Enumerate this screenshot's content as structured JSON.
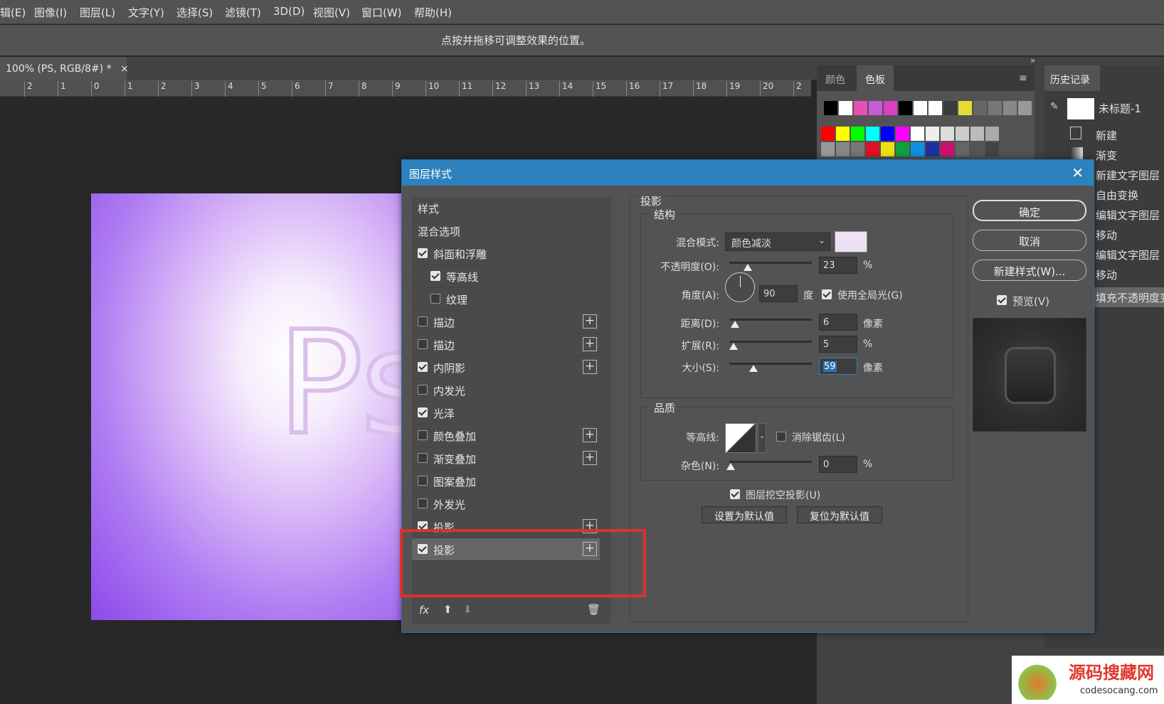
{
  "menu": [
    "辑(E)",
    "图像(I)",
    "图层(L)",
    "文字(Y)",
    "选择(S)",
    "滤镜(T)",
    "3D(D)",
    "视图(V)",
    "窗口(W)",
    "帮助(H)"
  ],
  "options_hint": "点按并拖移可调整效果的位置。",
  "doc_tab": {
    "label": "100% (PS, RGB/8#) *",
    "close": "×"
  },
  "ruler_ticks": [
    "2",
    "1",
    "0",
    "1",
    "2",
    "3",
    "4",
    "5",
    "6",
    "7",
    "8",
    "9",
    "10",
    "11",
    "12",
    "13",
    "14",
    "15",
    "16",
    "17",
    "18",
    "19",
    "20",
    "2"
  ],
  "canvas_text": "Ps",
  "swatch_tabs": {
    "color": "颜色",
    "swatches": "色板",
    "menu": "≡",
    "collapse": "»"
  },
  "history": {
    "tab": "历史记录",
    "snapshot": "未标题-1",
    "items": [
      "新建",
      "渐变",
      "新建文字图层",
      "自由变换",
      "编辑文字图层",
      "移动",
      "编辑文字图层",
      "移动",
      "填充不透明度变"
    ]
  },
  "dialog": {
    "title": "图层样式",
    "close": "✕",
    "styles": [
      {
        "label": "样式",
        "check": null,
        "plus": false
      },
      {
        "label": "混合选项",
        "check": null,
        "plus": false
      },
      {
        "label": "斜面和浮雕",
        "check": true,
        "plus": false
      },
      {
        "label": "等高线",
        "check": true,
        "plus": false,
        "indent": true
      },
      {
        "label": "纹理",
        "check": false,
        "plus": false,
        "indent": true
      },
      {
        "label": "描边",
        "check": false,
        "plus": true
      },
      {
        "label": "描边",
        "check": false,
        "plus": true
      },
      {
        "label": "内阴影",
        "check": true,
        "plus": true
      },
      {
        "label": "内发光",
        "check": false,
        "plus": false
      },
      {
        "label": "光泽",
        "check": true,
        "plus": false
      },
      {
        "label": "颜色叠加",
        "check": false,
        "plus": true
      },
      {
        "label": "渐变叠加",
        "check": false,
        "plus": true
      },
      {
        "label": "图案叠加",
        "check": false,
        "plus": false
      },
      {
        "label": "外发光",
        "check": false,
        "plus": false
      },
      {
        "label": "投影",
        "check": true,
        "plus": true
      },
      {
        "label": "投影",
        "check": true,
        "plus": true,
        "selected": true
      }
    ],
    "fx_label": "fx",
    "section_title": "投影",
    "structure": {
      "legend": "结构",
      "blend_mode_label": "混合模式:",
      "blend_mode_value": "颜色减淡",
      "blend_color": "#ece1f5",
      "opacity_label": "不透明度(O):",
      "opacity_value": "23",
      "opacity_unit": "%",
      "angle_label": "角度(A):",
      "angle_value": "90",
      "angle_unit": "度",
      "global_light_label": "使用全局光(G)",
      "distance_label": "距离(D):",
      "distance_value": "6",
      "distance_unit": "像素",
      "spread_label": "扩展(R):",
      "spread_value": "5",
      "spread_unit": "%",
      "size_label": "大小(S):",
      "size_value": "59",
      "size_unit": "像素"
    },
    "quality": {
      "legend": "品质",
      "contour_label": "等高线:",
      "antialias_label": "消除锯齿(L)",
      "noise_label": "杂色(N):",
      "noise_value": "0",
      "noise_unit": "%"
    },
    "knockout_label": "图层挖空投影(U)",
    "set_default": "设置为默认值",
    "reset_default": "复位为默认值",
    "ok": "确定",
    "cancel": "取消",
    "new_style": "新建样式(W)...",
    "preview_label": "预览(V)"
  },
  "watermark": {
    "title": "源码搜藏网",
    "url": "codesocang.com"
  }
}
